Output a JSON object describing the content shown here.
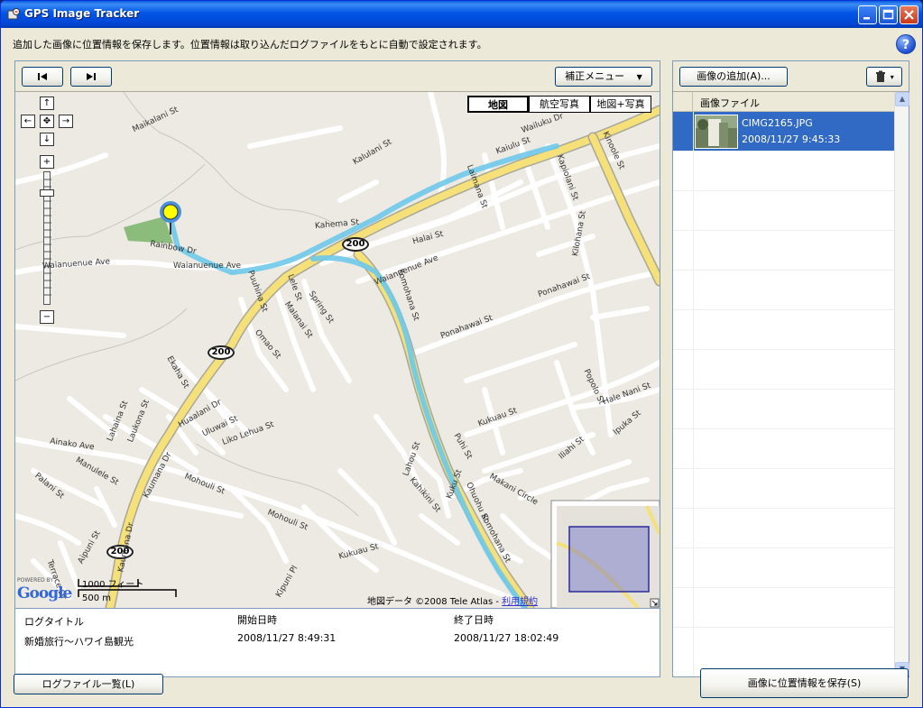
{
  "window": {
    "title": "GPS Image Tracker",
    "buttons": [
      "minimize",
      "maximize",
      "close"
    ]
  },
  "description": "追加した画像に位置情報を保存します。位置情報は取り込んだログファイルをもとに自動で設定されます。",
  "help_label": "?",
  "map_toolbar": {
    "prev_label": "|◀",
    "next_label": "▶|",
    "correction_menu_label": "補正メニュー"
  },
  "map": {
    "type_buttons": [
      "地図",
      "航空写真",
      "地図+写真"
    ],
    "selected_type": "地図",
    "pan_arrows": [
      "↑",
      "←",
      "✥",
      "→",
      "↓"
    ],
    "zoom_in": "+",
    "zoom_out": "−",
    "scale_feet": "1000 フィート",
    "scale_meters": "500 m",
    "powered_by": "POWERED BY",
    "google_logo": "Google",
    "attribution": "地図データ ©2008 Tele Atlas - ",
    "terms_link": "利用規約",
    "route_badges": [
      "200",
      "200",
      "200"
    ],
    "street_labels": [
      "Maikalani St",
      "Kalulani St",
      "Waianuenue Ave",
      "Waianuenue Ave",
      "Rainbow Dr",
      "Kaiulu St",
      "Waianuenue Ave",
      "Halai St",
      "Laimana St",
      "Kapiolani St",
      "Kinoole St",
      "Kaumana Dr",
      "Kaumana Dr",
      "Ainako Ave",
      "Mohouli St",
      "Mohouli St",
      "Komohana St",
      "Komohana St",
      "Ponahawai St",
      "Ponahawai St",
      "Puuhina St",
      "Lele St",
      "Spring St",
      "Malanai St",
      "Omao St",
      "Ekaha St",
      "Huaalani Dr",
      "Uluwai St",
      "Liko Lehua St",
      "Laukona St",
      "Lahaina St",
      "Kukuau St",
      "Kukuau St",
      "Hale Nani St",
      "Popolo St",
      "Ipuka St",
      "Kilohana St",
      "Puhi St",
      "Kahema St",
      "Palani St",
      "Aipuni St",
      "Kipuni Pl",
      "Terrace Dr",
      "Lahou St",
      "Kahikini St",
      "Kuku St",
      "Ohuohu St",
      "Manulele St",
      "Iliahi St",
      "Makani Circle",
      "Wailuku Dr"
    ]
  },
  "log_table": {
    "columns": [
      "ログタイトル",
      "開始日時",
      "終了日時"
    ],
    "row": {
      "title": "新婚旅行〜ハワイ島観光",
      "start": "2008/11/27 8:49:31",
      "end": "2008/11/27 18:02:49"
    }
  },
  "image_panel": {
    "add_button_label": "画像の追加(A)...",
    "trash_label": "▾",
    "column_header": "画像ファイル",
    "items": [
      {
        "filename": "CIMG2165.JPG",
        "datetime": "2008/11/27 9:45:33",
        "selected": true
      }
    ]
  },
  "footer": {
    "log_list_button": "ログファイル一覧(L)",
    "save_button": "画像に位置情報を保存(S)"
  },
  "colors": {
    "title_bar": "#0055e5",
    "selection": "#316ac5",
    "route_line": "#6ec9ea",
    "highway": "#f5e07a",
    "map_bg": "#eceae3"
  }
}
